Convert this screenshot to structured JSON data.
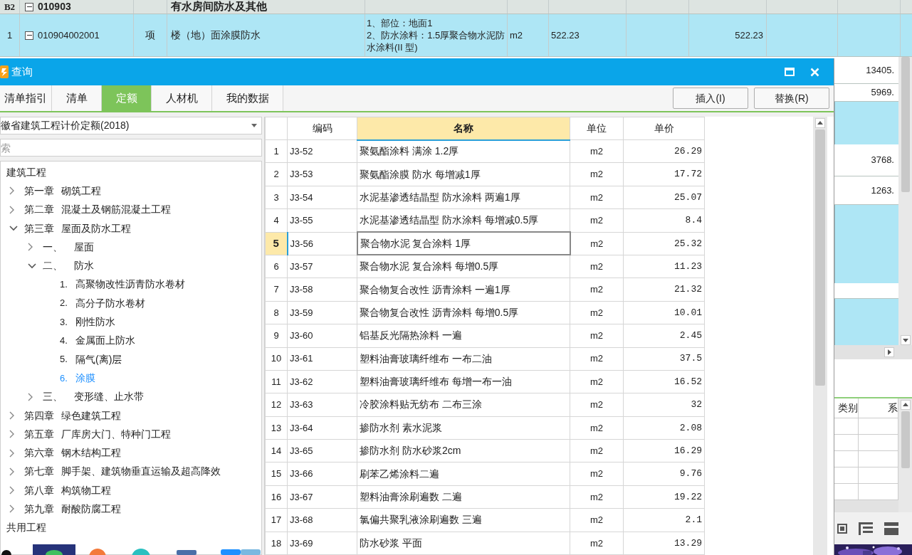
{
  "sheet": {
    "rows": [
      {
        "kind": "group",
        "index": "B2",
        "code": "010903",
        "name": "有水房间防水及其他"
      },
      {
        "kind": "item",
        "index": "1",
        "code": "010904002001",
        "type": "项",
        "name": "楼（地）面涂膜防水",
        "description": [
          "1、部位：地面1",
          "2、防水涂料：1.5厚聚合物水泥防水涂料(II 型)"
        ],
        "unit": "m2",
        "quantity": "522.23",
        "amount": "522.23"
      }
    ],
    "side_rows": [
      {
        "kind": "value",
        "text": "13405."
      },
      {
        "kind": "value",
        "text": "5969."
      },
      {
        "kind": "band"
      },
      {
        "kind": "value",
        "text": "3768."
      },
      {
        "kind": "value",
        "text": "1263."
      },
      {
        "kind": "band"
      },
      {
        "kind": "blank"
      },
      {
        "kind": "band"
      }
    ],
    "side_table": {
      "columns": [
        "类别",
        "系"
      ]
    }
  },
  "dialog": {
    "title": "查询",
    "tabs": [
      {
        "label": "清单指引",
        "selected": false
      },
      {
        "label": "清单",
        "selected": false
      },
      {
        "label": "定额",
        "selected": true
      },
      {
        "label": "人材机",
        "selected": false
      },
      {
        "label": "我的数据",
        "selected": false
      }
    ],
    "buttons": [
      "插入(I)",
      "替换(R)"
    ],
    "library": "徽省建筑工程计价定额(2018)",
    "search_placeholder": "索",
    "tree": [
      {
        "label": "建筑工程",
        "selected": false,
        "children": [
          {
            "number": "第一章",
            "label": "砌筑工程",
            "expanded": false,
            "selected": false
          },
          {
            "number": "第二章",
            "label": "混凝土及钢筋混凝土工程",
            "expanded": false,
            "selected": false
          },
          {
            "number": "第三章",
            "label": "屋面及防水工程",
            "expanded": true,
            "selected": false,
            "children": [
              {
                "number": "一、",
                "label": "屋面",
                "expanded": false,
                "selected": false
              },
              {
                "number": "二、",
                "label": "防水",
                "expanded": true,
                "selected": false,
                "children": [
                  {
                    "number": "1.",
                    "label": "高聚物改性沥青防水卷材",
                    "selected": false
                  },
                  {
                    "number": "2.",
                    "label": "高分子防水卷材",
                    "selected": false
                  },
                  {
                    "number": "3.",
                    "label": "刚性防水",
                    "selected": false
                  },
                  {
                    "number": "4.",
                    "label": "金属面上防水",
                    "selected": false
                  },
                  {
                    "number": "5.",
                    "label": "隔气(离)层",
                    "selected": false
                  },
                  {
                    "number": "6.",
                    "label": "涂膜",
                    "selected": true
                  }
                ]
              },
              {
                "number": "三、",
                "label": "变形缝、止水带",
                "expanded": false,
                "selected": false
              }
            ]
          },
          {
            "number": "第四章",
            "label": "绿色建筑工程",
            "expanded": false,
            "selected": false
          },
          {
            "number": "第五章",
            "label": "厂库房大门、特种门工程",
            "expanded": false,
            "selected": false
          },
          {
            "number": "第六章",
            "label": "钢木结构工程",
            "expanded": false,
            "selected": false
          },
          {
            "number": "第七章",
            "label": "脚手架、建筑物垂直运输及超高降效",
            "expanded": false,
            "selected": false
          },
          {
            "number": "第八章",
            "label": "构筑物工程",
            "expanded": false,
            "selected": false
          },
          {
            "number": "第九章",
            "label": "耐酸防腐工程",
            "expanded": false,
            "selected": false
          }
        ]
      },
      {
        "label": "共用工程",
        "selected": false
      }
    ],
    "table": {
      "columns": [
        {
          "label": "编码",
          "selected": false
        },
        {
          "label": "名称",
          "selected": true
        },
        {
          "label": "单位",
          "selected": false
        },
        {
          "label": "单价",
          "selected": false
        }
      ],
      "rows": [
        {
          "no": "1",
          "code": "J3-52",
          "name": "聚氨酯涂料 满涂 1.2厚",
          "unit": "m2",
          "price": "26.29",
          "selected": false
        },
        {
          "no": "2",
          "code": "J3-53",
          "name": "聚氨酯涂膜 防水 每增减1厚",
          "unit": "m2",
          "price": "17.72",
          "selected": false
        },
        {
          "no": "3",
          "code": "J3-54",
          "name": "水泥基渗透结晶型 防水涂料 两遍1厚",
          "unit": "m2",
          "price": "25.07",
          "selected": false
        },
        {
          "no": "4",
          "code": "J3-55",
          "name": "水泥基渗透结晶型 防水涂料 每增减0.5厚",
          "unit": "m2",
          "price": "8.4",
          "selected": false
        },
        {
          "no": "5",
          "code": "J3-56",
          "name": "聚合物水泥 复合涂料 1厚",
          "unit": "m2",
          "price": "25.32",
          "selected": true
        },
        {
          "no": "6",
          "code": "J3-57",
          "name": "聚合物水泥 复合涂料 每增0.5厚",
          "unit": "m2",
          "price": "11.23",
          "selected": false
        },
        {
          "no": "7",
          "code": "J3-58",
          "name": "聚合物复合改性 沥青涂料 一遍1厚",
          "unit": "m2",
          "price": "21.32",
          "selected": false
        },
        {
          "no": "8",
          "code": "J3-59",
          "name": "聚合物复合改性 沥青涂料 每增0.5厚",
          "unit": "m2",
          "price": "10.01",
          "selected": false
        },
        {
          "no": "9",
          "code": "J3-60",
          "name": "铝基反光隔热涂料 一遍",
          "unit": "m2",
          "price": "2.45",
          "selected": false
        },
        {
          "no": "10",
          "code": "J3-61",
          "name": "塑料油膏玻璃纤维布 一布二油",
          "unit": "m2",
          "price": "37.5",
          "selected": false
        },
        {
          "no": "11",
          "code": "J3-62",
          "name": "塑料油膏玻璃纤维布 每增一布一油",
          "unit": "m2",
          "price": "16.52",
          "selected": false
        },
        {
          "no": "12",
          "code": "J3-63",
          "name": "冷胶涂料贴无纺布 二布三涂",
          "unit": "m2",
          "price": "32",
          "selected": false
        },
        {
          "no": "13",
          "code": "J3-64",
          "name": "掺防水剂 素水泥浆",
          "unit": "m2",
          "price": "2.08",
          "selected": false
        },
        {
          "no": "14",
          "code": "J3-65",
          "name": "掺防水剂 防水砂浆2cm",
          "unit": "m2",
          "price": "16.29",
          "selected": false
        },
        {
          "no": "15",
          "code": "J3-66",
          "name": "刷苯乙烯涂料二遍",
          "unit": "m2",
          "price": "9.76",
          "selected": false
        },
        {
          "no": "16",
          "code": "J3-67",
          "name": "塑料油膏涂刷遍数 二遍",
          "unit": "m2",
          "price": "19.22",
          "selected": false
        },
        {
          "no": "17",
          "code": "J3-68",
          "name": "氯偏共聚乳液涂刷遍数 三遍",
          "unit": "m2",
          "price": "2.1",
          "selected": false
        },
        {
          "no": "18",
          "code": "J3-69",
          "name": "防水砂浆 平面",
          "unit": "m2",
          "price": "13.29",
          "selected": false
        }
      ]
    }
  }
}
